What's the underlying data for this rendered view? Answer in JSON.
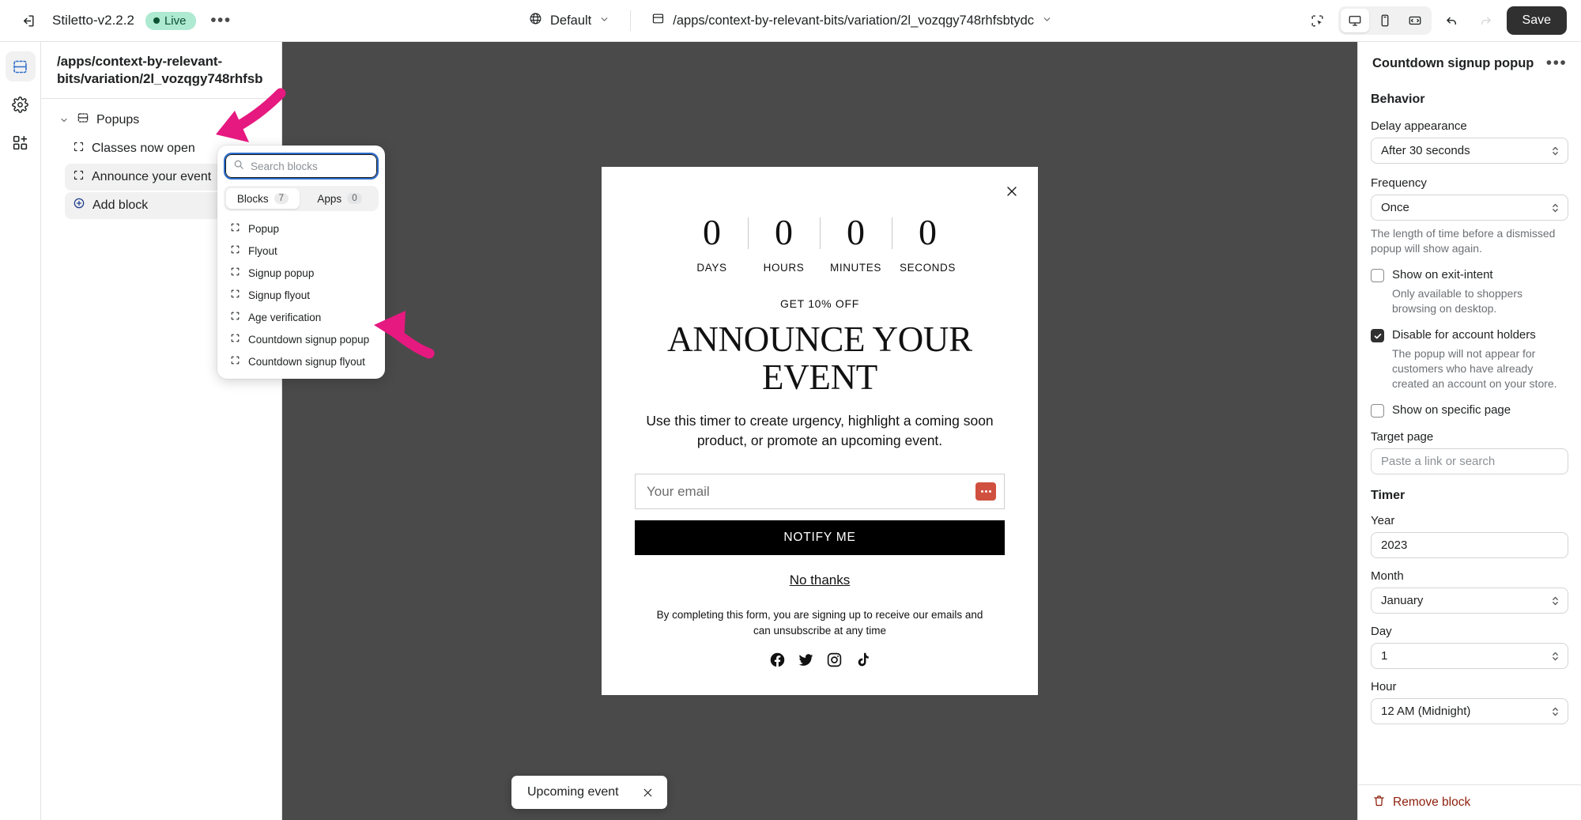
{
  "topbar": {
    "back_icon": "exit-icon",
    "app_title": "Stiletto-v2.2.2",
    "status_label": "Live",
    "more_label": "•••",
    "theme_selector": "Default",
    "page_path": "/apps/context-by-relevant-bits/variation/2l_vozqgy748rhfsbtydc",
    "save_label": "Save",
    "icons": {
      "inspector": "select-pointer-icon",
      "desktop": "desktop-icon",
      "mobile": "mobile-icon",
      "fullwidth": "full-width-icon",
      "undo": "undo-icon",
      "redo": "redo-icon"
    }
  },
  "rail": {
    "items": [
      {
        "name": "sections-icon",
        "label": "Sections",
        "active": true
      },
      {
        "name": "gear-icon",
        "label": "Settings",
        "active": false
      },
      {
        "name": "apps-add-icon",
        "label": "Apps",
        "active": false
      }
    ]
  },
  "sidebar": {
    "path_line1": "/apps/context-by-relevant-",
    "path_line2": "bits/variation/2l_vozqgy748rhfsb",
    "group_label": "Popups",
    "items": [
      {
        "label": "Classes now open",
        "selected": false
      },
      {
        "label": "Announce your event",
        "selected": true
      }
    ],
    "add_block_label": "Add block"
  },
  "picker": {
    "search_placeholder": "Search blocks",
    "search_value": "",
    "tabs": [
      {
        "label": "Blocks",
        "count": "7",
        "active": true
      },
      {
        "label": "Apps",
        "count": "0",
        "active": false
      }
    ],
    "blocks": [
      "Popup",
      "Flyout",
      "Signup popup",
      "Signup flyout",
      "Age verification",
      "Countdown signup popup",
      "Countdown signup flyout"
    ]
  },
  "preview": {
    "countdown": [
      {
        "value": "0",
        "label": "DAYS"
      },
      {
        "value": "0",
        "label": "HOURS"
      },
      {
        "value": "0",
        "label": "MINUTES"
      },
      {
        "value": "0",
        "label": "SECONDS"
      }
    ],
    "eyebrow": "GET 10% OFF",
    "title": "ANNOUNCE YOUR EVENT",
    "subtitle": "Use this timer to create urgency, highlight a coming soon product, or promote an upcoming event.",
    "email_placeholder": "Your email",
    "submit_label": "NOTIFY ME",
    "decline_label": "No thanks",
    "legal": "By completing this form, you are signing up to receive our emails and can unsubscribe at any time",
    "socials": [
      "facebook-icon",
      "twitter-icon",
      "instagram-icon",
      "tiktok-icon"
    ],
    "send_button_color": "#d0503f"
  },
  "toast": {
    "message": "Upcoming event",
    "close_icon": "close-icon"
  },
  "rightpanel": {
    "title": "Countdown signup popup",
    "more_label": "•••",
    "behavior_heading": "Behavior",
    "delay_label": "Delay appearance",
    "delay_value": "After 30 seconds",
    "frequency_label": "Frequency",
    "frequency_value": "Once",
    "frequency_help": "The length of time before a dismissed popup will show again.",
    "exit_intent_label": "Show on exit-intent",
    "exit_intent_checked": false,
    "exit_intent_help": "Only available to shoppers browsing on desktop.",
    "disable_accounts_label": "Disable for account holders",
    "disable_accounts_checked": true,
    "disable_accounts_help": "The popup will not appear for customers who have already created an account on your store.",
    "specific_page_label": "Show on specific page",
    "specific_page_checked": false,
    "target_page_label": "Target page",
    "target_page_placeholder": "Paste a link or search",
    "timer_heading": "Timer",
    "year_label": "Year",
    "year_value": "2023",
    "month_label": "Month",
    "month_value": "January",
    "day_label": "Day",
    "day_value": "1",
    "hour_label": "Hour",
    "hour_value": "12 AM (Midnight)",
    "remove_label": "Remove block",
    "remove_color": "#8e1f0b"
  },
  "annotations": {
    "arrow_color": "#e5197f",
    "arrow_1_target": "Classes now open",
    "arrow_2_target": "Countdown signup popup"
  }
}
